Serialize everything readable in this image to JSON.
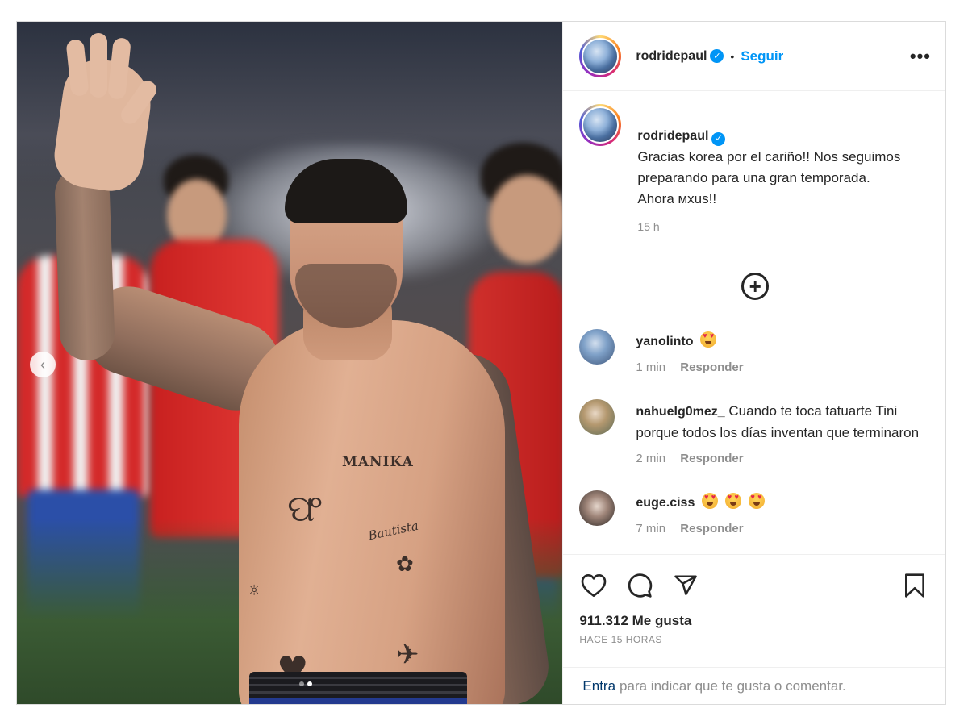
{
  "header": {
    "username": "rodridepaul",
    "bullet": "•",
    "follow_label": "Seguir",
    "more_label": "•••"
  },
  "caption": {
    "username": "rodridepaul",
    "text": "Gracias korea por el cariño!! Nos seguimos preparando para una gran temporada.\nAhora мxus!!",
    "time": "15 h"
  },
  "load_more_label": "+",
  "comments": [
    {
      "username": "yanolinto",
      "text": "",
      "emoji_count": 1,
      "time": "1 min",
      "reply_label": "Responder"
    },
    {
      "username": "nahuelg0mez_",
      "text": "Cuando te toca tatuarte Tini porque todos los días inventan que terminaron",
      "emoji_count": 0,
      "time": "2 min",
      "reply_label": "Responder"
    },
    {
      "username": "euge.ciss",
      "text": "",
      "emoji_count": 3,
      "time": "7 min",
      "reply_label": "Responder"
    }
  ],
  "actions": {
    "icons": [
      "heart-icon",
      "comment-icon",
      "share-icon",
      "bookmark-icon"
    ],
    "likes": "911.312 Me gusta",
    "date": "HACE 15 HORAS"
  },
  "login": {
    "link": "Entra",
    "text": "para indicar que te gusta o comentar."
  },
  "media": {
    "tattoo_text": "MANIKA",
    "tattoo_script": "Bautista",
    "carousel_count": 2,
    "carousel_active": 1
  },
  "colors": {
    "accent": "#0095f6",
    "text": "#262626",
    "muted": "#8e8e8e",
    "border": "#dbdbdb"
  }
}
